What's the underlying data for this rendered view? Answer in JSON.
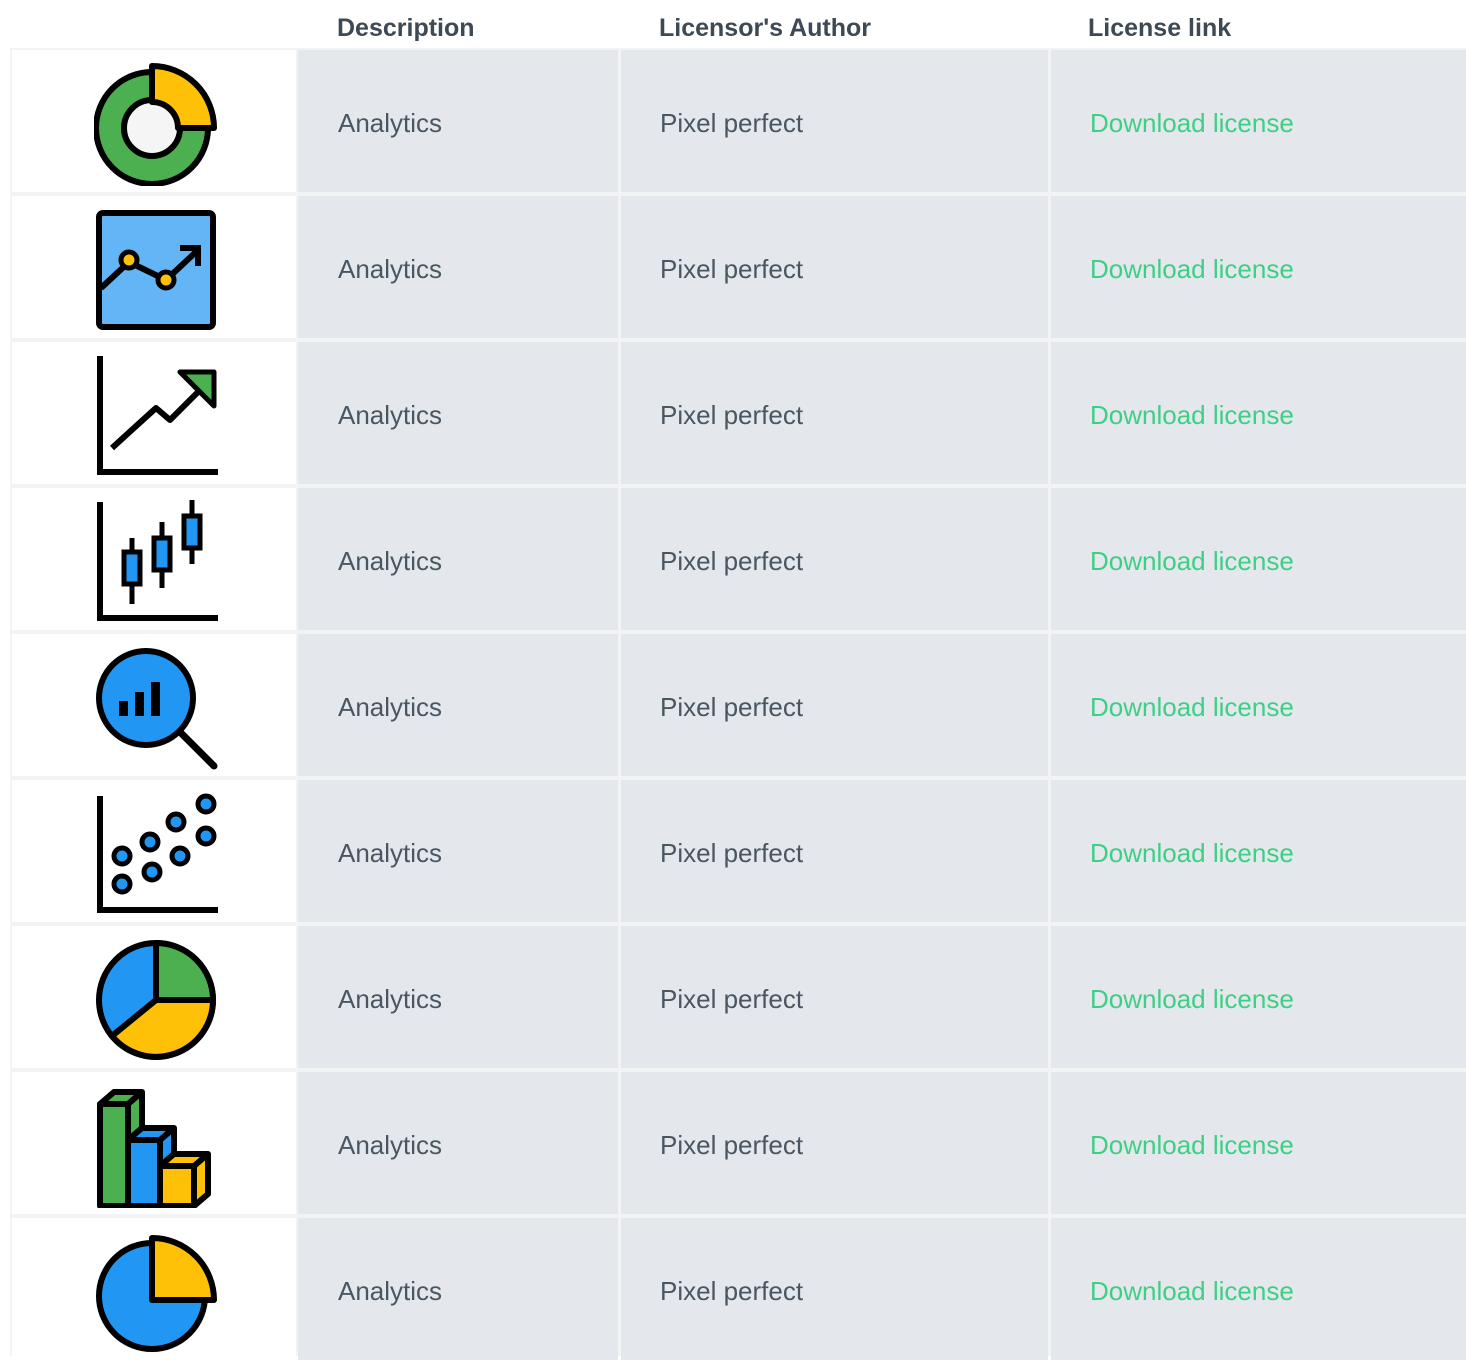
{
  "header": {
    "description": "Description",
    "author": "Licensor's Author",
    "license_link": "License link"
  },
  "colors": {
    "link": "#3ecf85",
    "text": "#4a5661",
    "cell_bg": "#e4e8ec",
    "green": "#4caf50",
    "yellow": "#ffc107",
    "blue": "#2196f3",
    "light_blue": "#64b5f6"
  },
  "rows": [
    {
      "icon": "donut-chart-icon",
      "description": "Analytics",
      "author": "Pixel perfect",
      "link": "Download license"
    },
    {
      "icon": "line-chart-icon",
      "description": "Analytics",
      "author": "Pixel perfect",
      "link": "Download license"
    },
    {
      "icon": "trend-arrow-icon",
      "description": "Analytics",
      "author": "Pixel perfect",
      "link": "Download license"
    },
    {
      "icon": "candlestick-chart-icon",
      "description": "Analytics",
      "author": "Pixel perfect",
      "link": "Download license"
    },
    {
      "icon": "magnifier-chart-icon",
      "description": "Analytics",
      "author": "Pixel perfect",
      "link": "Download license"
    },
    {
      "icon": "scatter-plot-icon",
      "description": "Analytics",
      "author": "Pixel perfect",
      "link": "Download license"
    },
    {
      "icon": "pie-chart-icon",
      "description": "Analytics",
      "author": "Pixel perfect",
      "link": "Download license"
    },
    {
      "icon": "3d-bar-chart-icon",
      "description": "Analytics",
      "author": "Pixel perfect",
      "link": "Download license"
    },
    {
      "icon": "pie-slice-icon",
      "description": "Analytics",
      "author": "Pixel perfect",
      "link": "Download license"
    }
  ]
}
